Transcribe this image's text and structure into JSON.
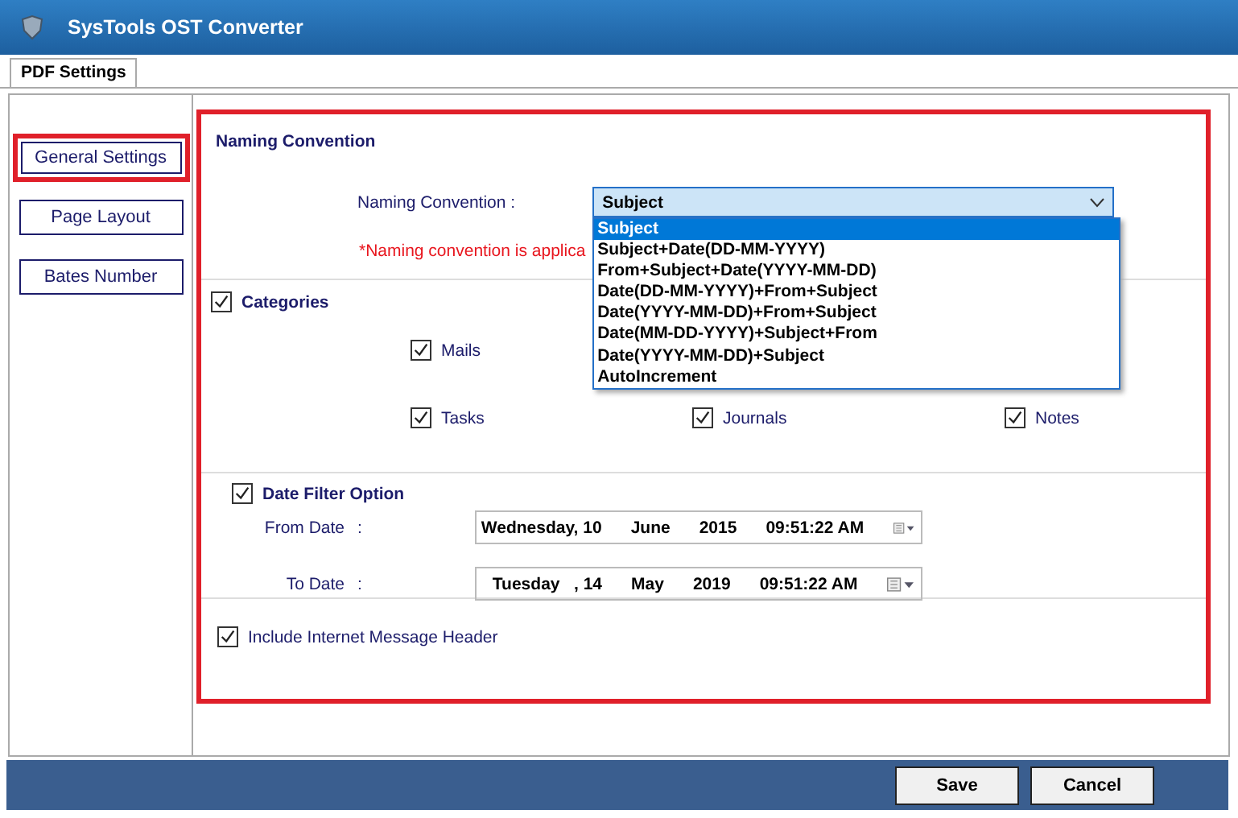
{
  "window": {
    "title": "SysTools  OST Converter"
  },
  "tabs": [
    {
      "label": "PDF Settings",
      "selected": true
    }
  ],
  "sidebar": {
    "items": [
      {
        "label": "General Settings",
        "selected": true
      },
      {
        "label": "Page Layout",
        "selected": false
      },
      {
        "label": "Bates Number",
        "selected": false
      }
    ]
  },
  "naming": {
    "title": "Naming Convention",
    "label": "Naming Convention :",
    "value": "Subject",
    "expanded": true,
    "options": [
      {
        "label": "Subject",
        "selected": true
      },
      {
        "label": "Subject+Date(DD-MM-YYYY)",
        "selected": false
      },
      {
        "label": "From+Subject+Date(YYYY-MM-DD)",
        "selected": false
      },
      {
        "label": "Date(DD-MM-YYYY)+From+Subject",
        "selected": false
      },
      {
        "label": "Date(YYYY-MM-DD)+From+Subject",
        "selected": false
      },
      {
        "label": "Date(MM-DD-YYYY)+Subject+From",
        "selected": false
      },
      {
        "label": "Date(YYYY-MM-DD)+Subject",
        "selected": false
      },
      {
        "label": "AutoIncrement",
        "selected": false
      }
    ],
    "note": "*Naming convention is applica"
  },
  "categories": {
    "label": "Categories",
    "checked": true,
    "rows": [
      [
        {
          "label": "Mails",
          "checked": true
        }
      ],
      [
        {
          "label": "Tasks",
          "checked": true
        },
        {
          "label": "Journals",
          "checked": true
        },
        {
          "label": "Notes",
          "checked": true
        }
      ]
    ]
  },
  "date_filter": {
    "label": "Date Filter Option",
    "checked": true,
    "dates": [
      {
        "label": "From Date",
        "colon": ":",
        "parts": [
          "Wednesday, 10",
          "June",
          "2015",
          "09:51:22 AM"
        ]
      },
      {
        "label": "To Date",
        "colon": ":",
        "parts": [
          "Tuesday   , 14",
          "May",
          "2019",
          "09:51:22 AM"
        ]
      }
    ]
  },
  "internet_header": {
    "label": "Include Internet Message Header",
    "checked": true
  },
  "buttons": [
    "Save",
    "Cancel"
  ]
}
